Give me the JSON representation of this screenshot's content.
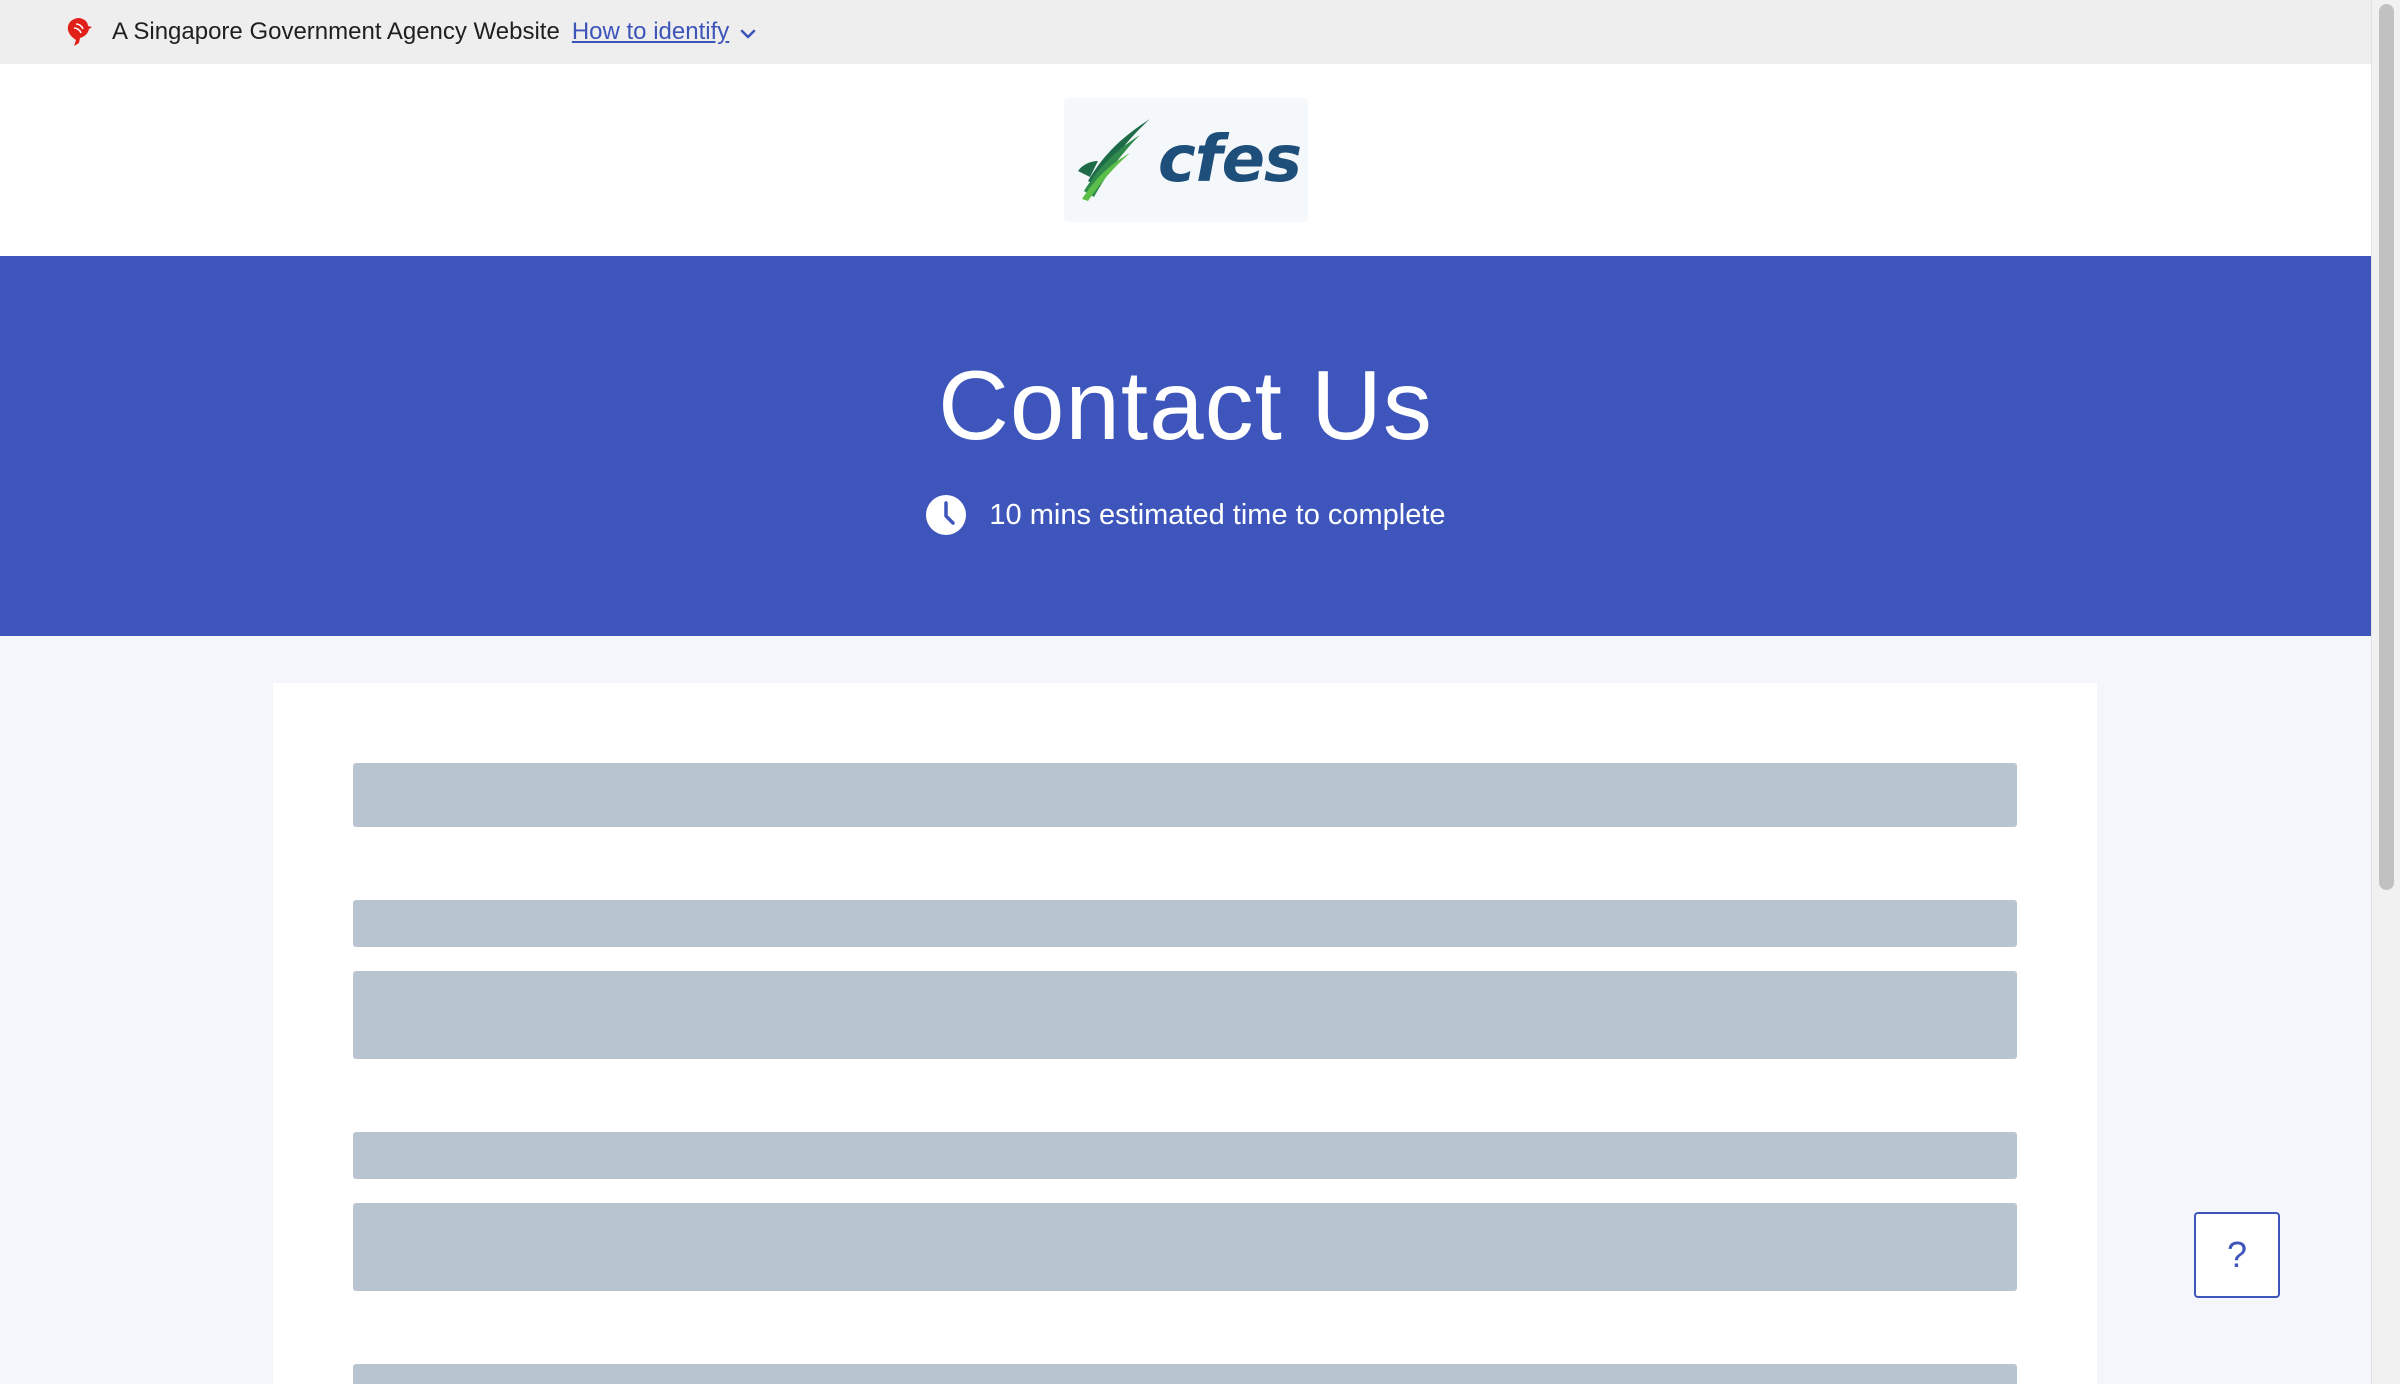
{
  "masthead": {
    "agency_text": "A Singapore Government Agency Website",
    "identify_link": "How to identify",
    "lion_icon": "singapore-lion-icon",
    "chevron_icon": "chevron-down-icon",
    "accent_color": "#3d55b9"
  },
  "logo": {
    "text": "cfes",
    "colors": {
      "text": "#1e4e7a",
      "leaf_dark": "#1e6b4a",
      "leaf_light": "#5cbf4a"
    }
  },
  "hero": {
    "title": "Contact Us",
    "estimate": "10 mins estimated time to complete",
    "clock_icon": "clock-icon",
    "background": "#3e56bb"
  },
  "help": {
    "label": "?"
  },
  "colors": {
    "page_bg": "#f4f6fb",
    "skeleton": "#b8c5d1"
  }
}
